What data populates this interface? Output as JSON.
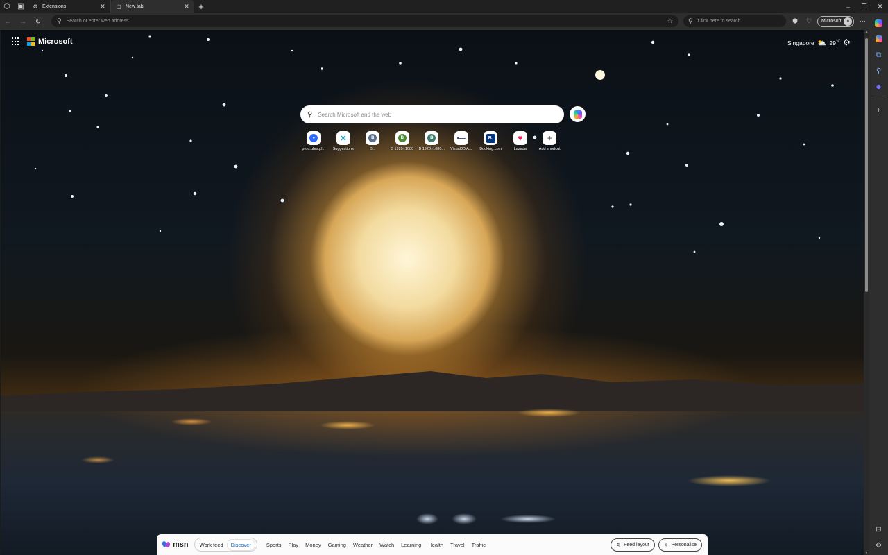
{
  "browser": {
    "tabs": [
      {
        "label": "Extensions",
        "icon": "gear-icon",
        "active": false
      },
      {
        "label": "New tab",
        "icon": "page-icon",
        "active": true
      }
    ],
    "address_placeholder": "Search or enter web address",
    "side_search_placeholder": "Click here to search",
    "profile_label": "Microsoft"
  },
  "page": {
    "brand": "Microsoft",
    "weather": {
      "city": "Singapore",
      "temp": "29",
      "unit": "°C",
      "icon": "cloud-sun-icon"
    },
    "search_placeholder": "Search Microsoft and the web",
    "shortcuts": [
      {
        "label": "prod.uhrs.pl...",
        "icon": "uhrs-icon",
        "color": "#2b6cff"
      },
      {
        "label": "Suggestions",
        "icon": "suggestions-icon",
        "color": "#1fa0c9"
      },
      {
        "label": "B...",
        "icon": "b-icon",
        "color": "#5a6f8a"
      },
      {
        "label": "B 1920×1080",
        "icon": "b-green-icon",
        "color": "#4e8c3a"
      },
      {
        "label": "B 1920×1080...",
        "icon": "b-teal-icon",
        "color": "#3d7a6a"
      },
      {
        "label": "Visual3D A...",
        "icon": "visual3d-icon",
        "color": "#2b4e8c"
      },
      {
        "label": "Booking.com",
        "icon": "booking-icon",
        "color": "#003580"
      },
      {
        "label": "Lazada",
        "icon": "lazada-icon",
        "color": "#f0245f"
      },
      {
        "label": "Add shortcut",
        "icon": "plus-icon",
        "color": "#444444"
      }
    ]
  },
  "msn": {
    "logo": "msn",
    "toggle": {
      "work": "Work feed",
      "discover": "Discover"
    },
    "categories": [
      "Sports",
      "Play",
      "Money",
      "Gaming",
      "Weather",
      "Watch",
      "Learning",
      "Health",
      "Travel",
      "Traffic"
    ],
    "feed_layout": "Feed layout",
    "personalise": "Personalise"
  }
}
